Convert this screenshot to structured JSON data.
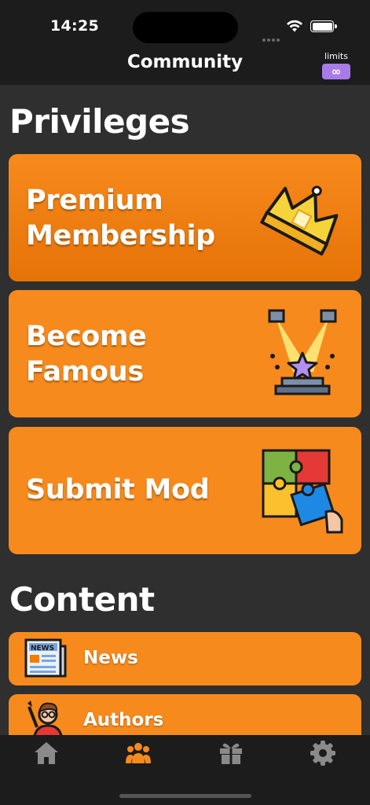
{
  "status_bar": {
    "time": "14:25"
  },
  "nav": {
    "title": "Community",
    "limits_label": "limits",
    "limits_value": "∞"
  },
  "sections": {
    "privileges_title": "Privileges",
    "content_title": "Content"
  },
  "privileges": [
    {
      "label_line1": "Premium",
      "label_line2": "Membership",
      "icon": "crown-icon"
    },
    {
      "label_line1": "Become",
      "label_line2": "Famous",
      "icon": "spotlight-star-icon"
    },
    {
      "label_line1": "Submit Mod",
      "icon": "puzzle-icon"
    }
  ],
  "content_items": [
    {
      "label": "News",
      "icon": "newspaper-icon"
    },
    {
      "label": "Authors",
      "icon": "author-icon"
    }
  ],
  "tabs": [
    {
      "name": "home",
      "icon": "home-icon",
      "active": false
    },
    {
      "name": "community",
      "icon": "community-icon",
      "active": true
    },
    {
      "name": "gifts",
      "icon": "gift-icon",
      "active": false
    },
    {
      "name": "settings",
      "icon": "gear-icon",
      "active": false
    }
  ],
  "colors": {
    "accent": "#f78a1d",
    "background": "#2f2f2f",
    "bars": "#1c1c1c",
    "tab_active": "#f78a1d",
    "tab_inactive": "#8a8a8a",
    "limits_badge": "#a97be8"
  }
}
